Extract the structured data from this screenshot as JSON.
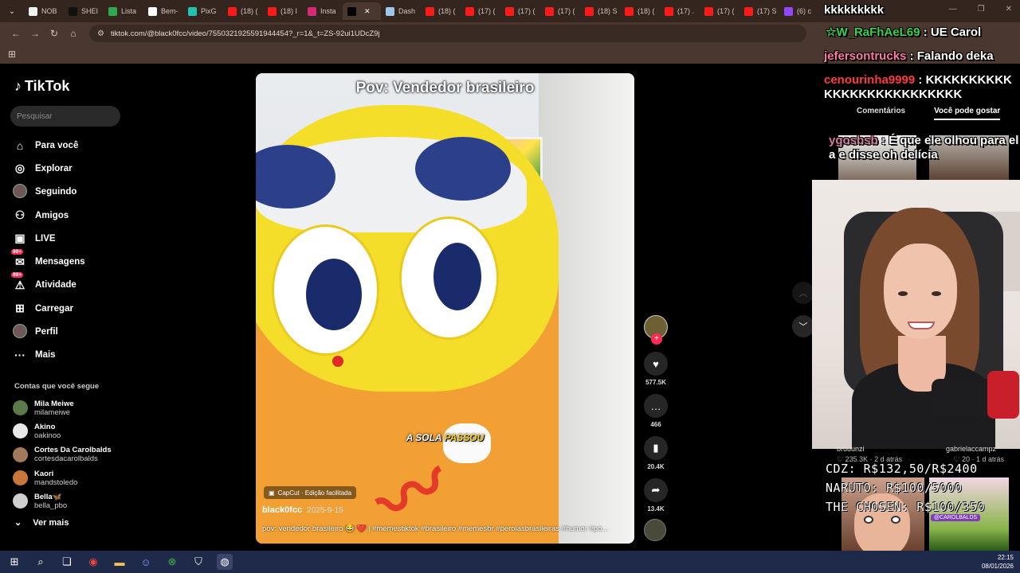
{
  "browser": {
    "tabs": [
      {
        "label": "NOB",
        "color": "#f2f2f2",
        "active": false
      },
      {
        "label": "SHEI",
        "color": "#111111",
        "active": false
      },
      {
        "label": "Lista",
        "color": "#2fa84f",
        "active": false
      },
      {
        "label": "Bem-",
        "color": "#ffffff",
        "active": false
      },
      {
        "label": "PixG",
        "color": "#21c2b0",
        "active": false
      },
      {
        "label": "(18) (",
        "color": "#ff1a1a",
        "active": false
      },
      {
        "label": "(18) I",
        "color": "#ff1a1a",
        "active": false
      },
      {
        "label": "Insta",
        "color": "#d62976",
        "active": false
      },
      {
        "label": "",
        "color": "#000000",
        "active": true
      },
      {
        "label": "Dash",
        "color": "#9fc6e8",
        "active": false
      },
      {
        "label": "(18) (",
        "color": "#ff1a1a",
        "active": false
      },
      {
        "label": "(17) (",
        "color": "#ff1a1a",
        "active": false
      },
      {
        "label": "(17) (",
        "color": "#ff1a1a",
        "active": false
      },
      {
        "label": "(17) (",
        "color": "#ff1a1a",
        "active": false
      },
      {
        "label": "(18) S",
        "color": "#ff1a1a",
        "active": false
      },
      {
        "label": "(18) (",
        "color": "#ff1a1a",
        "active": false
      },
      {
        "label": "(17) .",
        "color": "#ff1a1a",
        "active": false
      },
      {
        "label": "(17) (",
        "color": "#ff1a1a",
        "active": false
      },
      {
        "label": "(17) S",
        "color": "#ff1a1a",
        "active": false
      },
      {
        "label": "(6) c",
        "color": "#9146ff",
        "active": false
      }
    ],
    "url": "tiktok.com/@black0fcc/video/7550321925591944454?_r=1&_t=ZS-92ui1UDcZ9j"
  },
  "tiktok": {
    "logo_text": "TikTok",
    "search_placeholder": "Pesquisar",
    "nav": [
      {
        "label": "Para você",
        "icon": "home-icon",
        "glyph": "⌂"
      },
      {
        "label": "Explorar",
        "icon": "compass-icon",
        "glyph": "◎"
      },
      {
        "label": "Seguindo",
        "icon": "following-avatar-icon",
        "glyph": ""
      },
      {
        "label": "Amigos",
        "icon": "friends-icon",
        "glyph": "⚇"
      },
      {
        "label": "LIVE",
        "icon": "live-icon",
        "glyph": "▣"
      },
      {
        "label": "Mensagens",
        "icon": "messages-icon",
        "glyph": "✉",
        "badge": "99+"
      },
      {
        "label": "Atividade",
        "icon": "activity-icon",
        "glyph": "⚠",
        "badge": "99+"
      },
      {
        "label": "Carregar",
        "icon": "upload-icon",
        "glyph": "⊞"
      },
      {
        "label": "Perfil",
        "icon": "profile-avatar-icon",
        "glyph": ""
      },
      {
        "label": "Mais",
        "icon": "more-icon",
        "glyph": "···"
      }
    ],
    "following_title": "Contas que você segue",
    "accounts": [
      {
        "name": "Mila Meiwe",
        "handle": "milameiwe",
        "color": "#5a7a4a"
      },
      {
        "name": "Akino",
        "handle": "oakinoo",
        "color": "#e8e8e8"
      },
      {
        "name": "Cortes Da Carolbalds",
        "handle": "cortesdacarolbalds",
        "color": "#a07a5a"
      },
      {
        "name": "Kaori",
        "handle": "mandstoledo",
        "color": "#c9783a"
      },
      {
        "name": "Bella🦋",
        "handle": "bella_pbo",
        "color": "#d0d0d0"
      }
    ],
    "ver_mais": "Ver mais",
    "video": {
      "title": "Pov: Vendedor brasileiro",
      "caption_a": "A SOLA ",
      "caption_b": "PASSOU",
      "capcut": "CapCut · Edição facilitada",
      "author": "black0fcc",
      "date": "2025-9-15",
      "description": "pov: vendedor brasileiro 😂 ❤️ | #memestiktok #brasileiro #memesbr #perolasbrasileiras #humor #po..."
    },
    "actions": {
      "likes": "577.5K",
      "comments": "466",
      "saves": "20.4K",
      "shares": "13.4K"
    },
    "right_tabs": {
      "comments": "Comentários",
      "suggested": "Você pode gostar"
    }
  },
  "chat": [
    {
      "user": "",
      "text": "kkkkkkkkk",
      "user_color": "#ffffff"
    },
    {
      "user": "☆W_RaFhAeL69",
      "text": "UE Carol",
      "user_color": "#38d44a"
    },
    {
      "user": "jefersontrucks",
      "text": "Falando deka",
      "user_color": "#ff7aa8"
    },
    {
      "user": "cenourinha9999",
      "text": "KKKKKKKKKKKKKKKKKKKKKKKKKK",
      "user_color": "#ff3b3b"
    },
    {
      "user": "ygosbsb",
      "text": "É que ele olhou para ela e disse oh delícia",
      "user_color": "#d17aa0"
    }
  ],
  "under_webcam": {
    "user1": "bruuunzi",
    "user2": "gabrielaccampz",
    "stat1": "♡ 235.3K · 2 d atrás",
    "stat2": "♡ 20 · 1 d atrás"
  },
  "goals": [
    "CDZ: R$132,50/R$2400",
    "NARUTO: R$100/5000",
    "THE CHOSEN: R$100/350"
  ],
  "cam3_tag": "@CAROLBALDS",
  "taskbar": {
    "icons": [
      "windows-start-icon",
      "search-icon",
      "task-view-icon",
      "chrome-icon",
      "file-explorer-icon",
      "discord-icon",
      "xbox-icon",
      "security-icon",
      "obs-icon"
    ],
    "time": "22:15",
    "date": "08/01/2026"
  }
}
